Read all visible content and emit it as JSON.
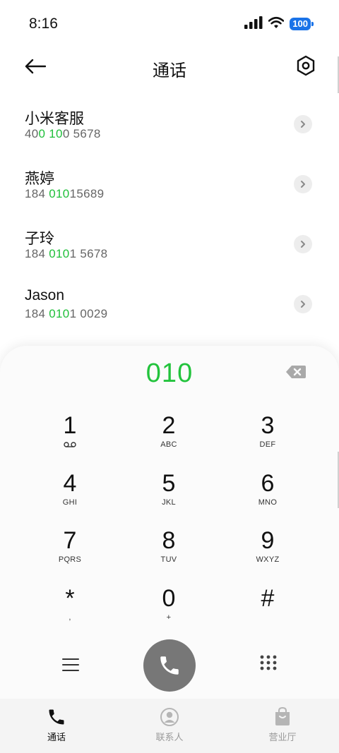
{
  "status": {
    "time": "8:16",
    "battery": "100"
  },
  "header": {
    "title": "通话"
  },
  "results": [
    {
      "name": "小米客服",
      "number_parts": [
        "40",
        "0 10",
        "0 5678"
      ]
    },
    {
      "name": "燕婷",
      "number_parts": [
        "184 ",
        "010",
        "15689"
      ]
    },
    {
      "name": "子玲",
      "number_parts": [
        "184 ",
        "010",
        "1 5678"
      ]
    },
    {
      "name": "Jason",
      "number_parts": [
        "184 ",
        "010",
        "1 0029"
      ]
    }
  ],
  "dialpad": {
    "number": "010",
    "keys": [
      {
        "digit": "1",
        "letters": ""
      },
      {
        "digit": "2",
        "letters": "ABC"
      },
      {
        "digit": "3",
        "letters": "DEF"
      },
      {
        "digit": "4",
        "letters": "GHI"
      },
      {
        "digit": "5",
        "letters": "JKL"
      },
      {
        "digit": "6",
        "letters": "MNO"
      },
      {
        "digit": "7",
        "letters": "PQRS"
      },
      {
        "digit": "8",
        "letters": "TUV"
      },
      {
        "digit": "9",
        "letters": "WXYZ"
      },
      {
        "digit": "*",
        "letters": ","
      },
      {
        "digit": "0",
        "letters": "+"
      },
      {
        "digit": "#",
        "letters": ""
      }
    ]
  },
  "nav": {
    "items": [
      {
        "label": "通话",
        "icon": "phone-icon",
        "active": true
      },
      {
        "label": "联系人",
        "icon": "person-icon",
        "active": false
      },
      {
        "label": "营业厅",
        "icon": "shopping-bag-icon",
        "active": false
      }
    ]
  },
  "colors": {
    "highlight": "#1fbf3a",
    "battery": "#1a73e8",
    "call_button": "#777777"
  }
}
